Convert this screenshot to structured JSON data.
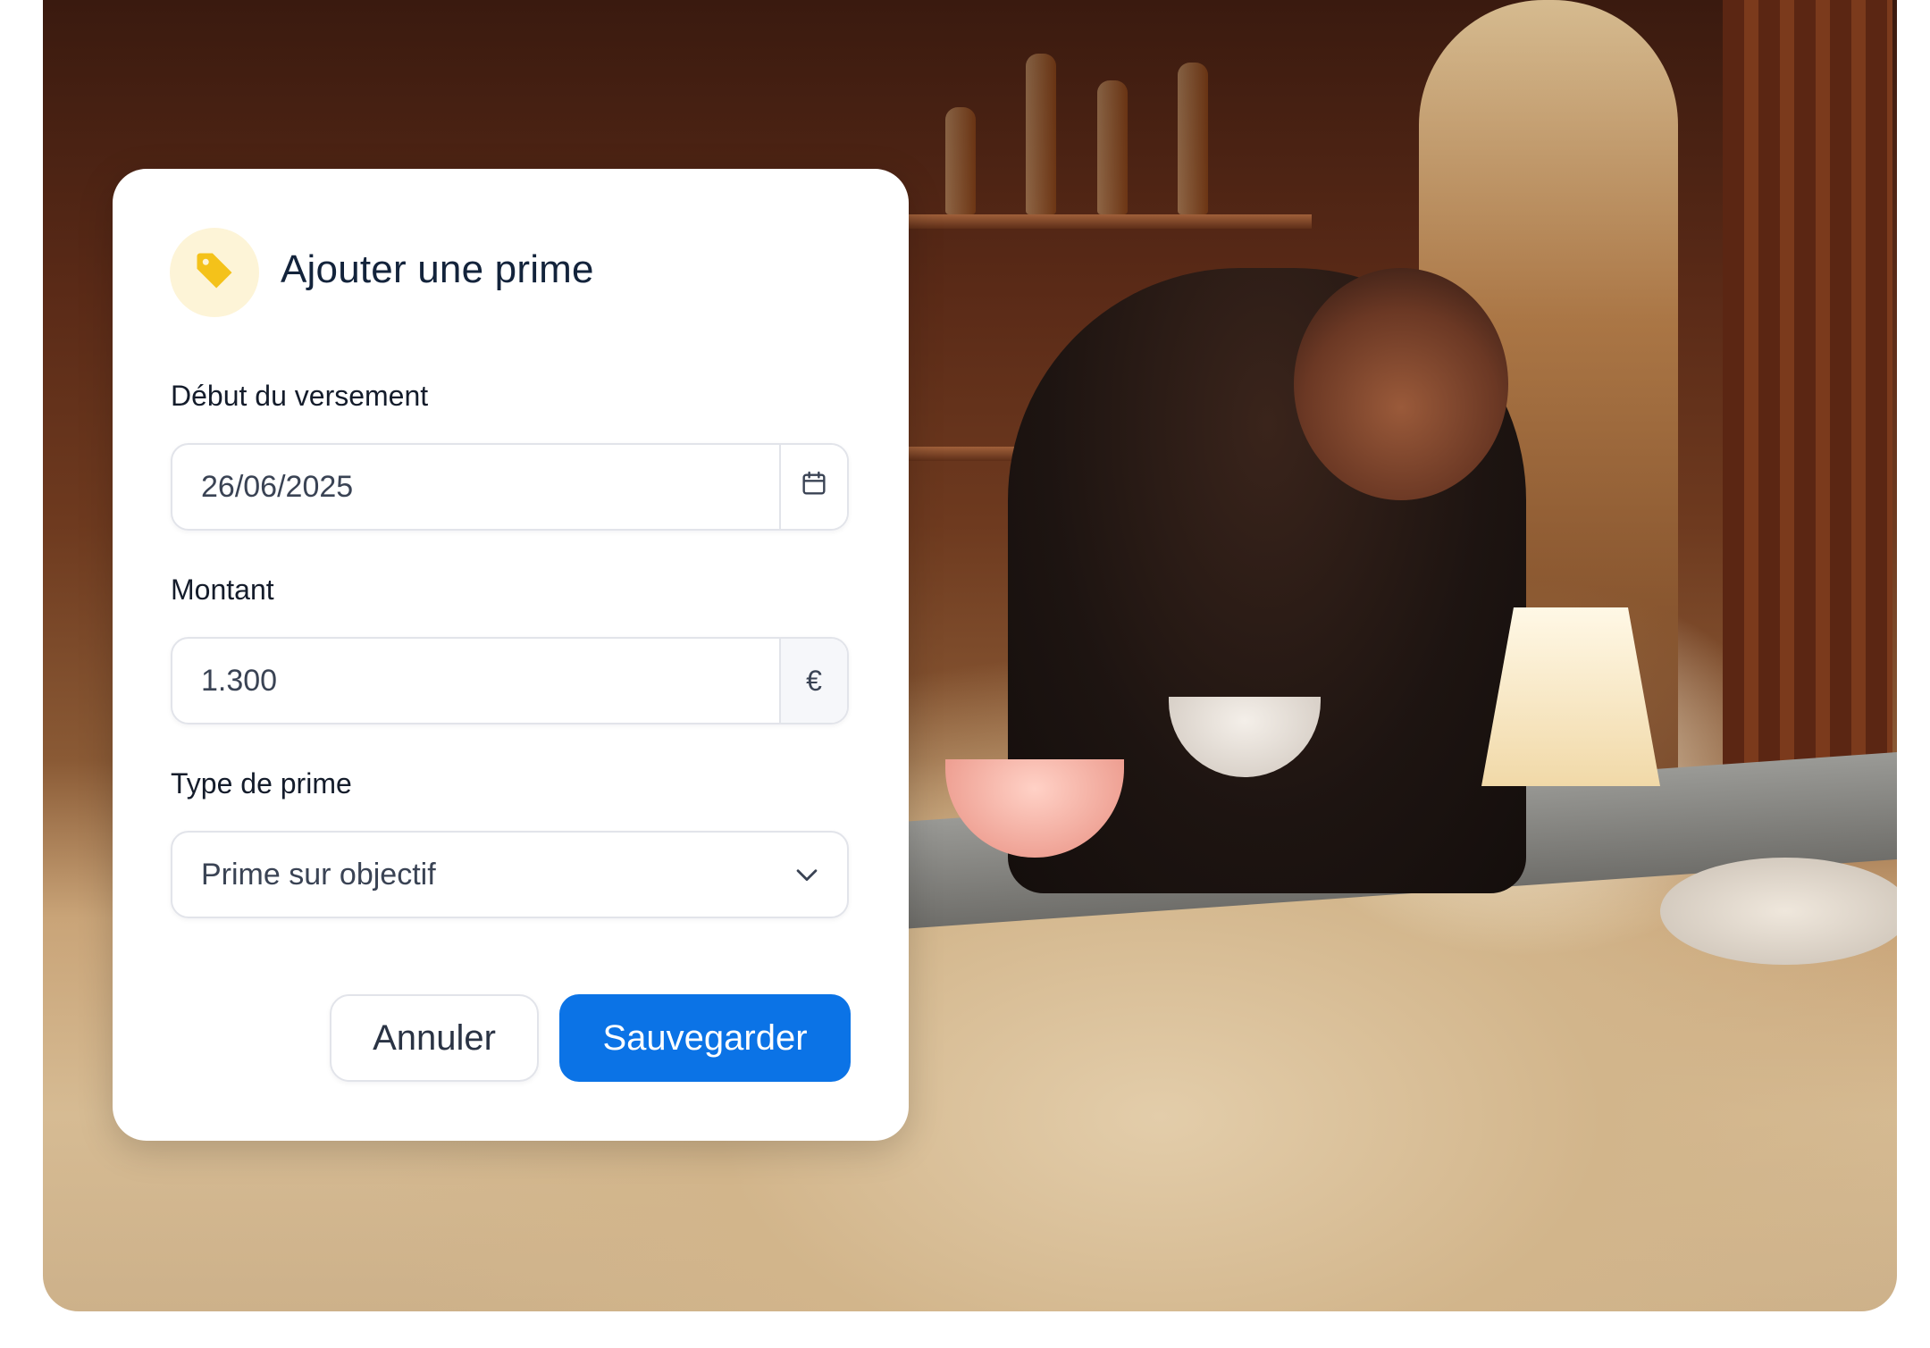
{
  "dialog": {
    "title": "Ajouter une prime",
    "icon": "tag-icon",
    "icon_color": "#f4c21a"
  },
  "fields": {
    "start": {
      "label": "Début du versement",
      "value": "26/06/2025",
      "icon": "calendar-icon"
    },
    "amount": {
      "label": "Montant",
      "value": "1.300",
      "currency": "€"
    },
    "type": {
      "label": "Type de prime",
      "value": "Prime sur objectif",
      "icon": "chevron-down-icon"
    }
  },
  "actions": {
    "cancel_label": "Annuler",
    "save_label": "Sauvegarder",
    "save_color": "#0b73e6"
  }
}
